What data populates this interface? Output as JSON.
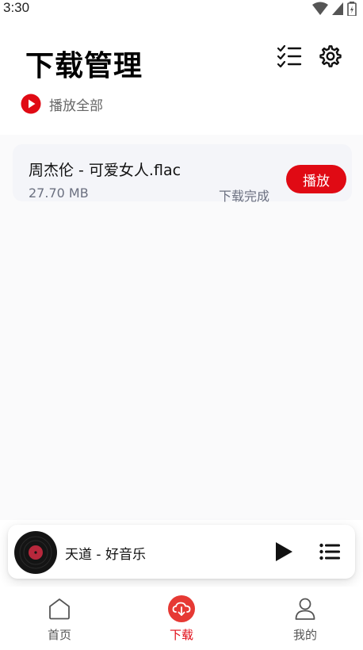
{
  "status_bar": {
    "time": "3:30"
  },
  "header": {
    "title": "下载管理"
  },
  "play_all": {
    "label": "播放全部"
  },
  "downloads": [
    {
      "title": "周杰伦 - 可爱女人.flac",
      "size": "27.70 MB",
      "status": "下载完成",
      "play_label": "播放"
    }
  ],
  "mini_player": {
    "song": "天道 - 好音乐"
  },
  "nav": {
    "home_label": "首页",
    "download_label": "下载",
    "mine_label": "我的",
    "active": "download"
  },
  "colors": {
    "accent": "#e00a14",
    "text_secondary": "#6b7080",
    "card_bg": "#f4f5f9"
  },
  "icons": [
    "wifi-icon",
    "signal-icon",
    "battery-icon",
    "checklist-icon",
    "gear-icon",
    "play-circle-icon",
    "play-icon",
    "playlist-icon",
    "home-icon",
    "download-cloud-icon",
    "user-icon"
  ]
}
